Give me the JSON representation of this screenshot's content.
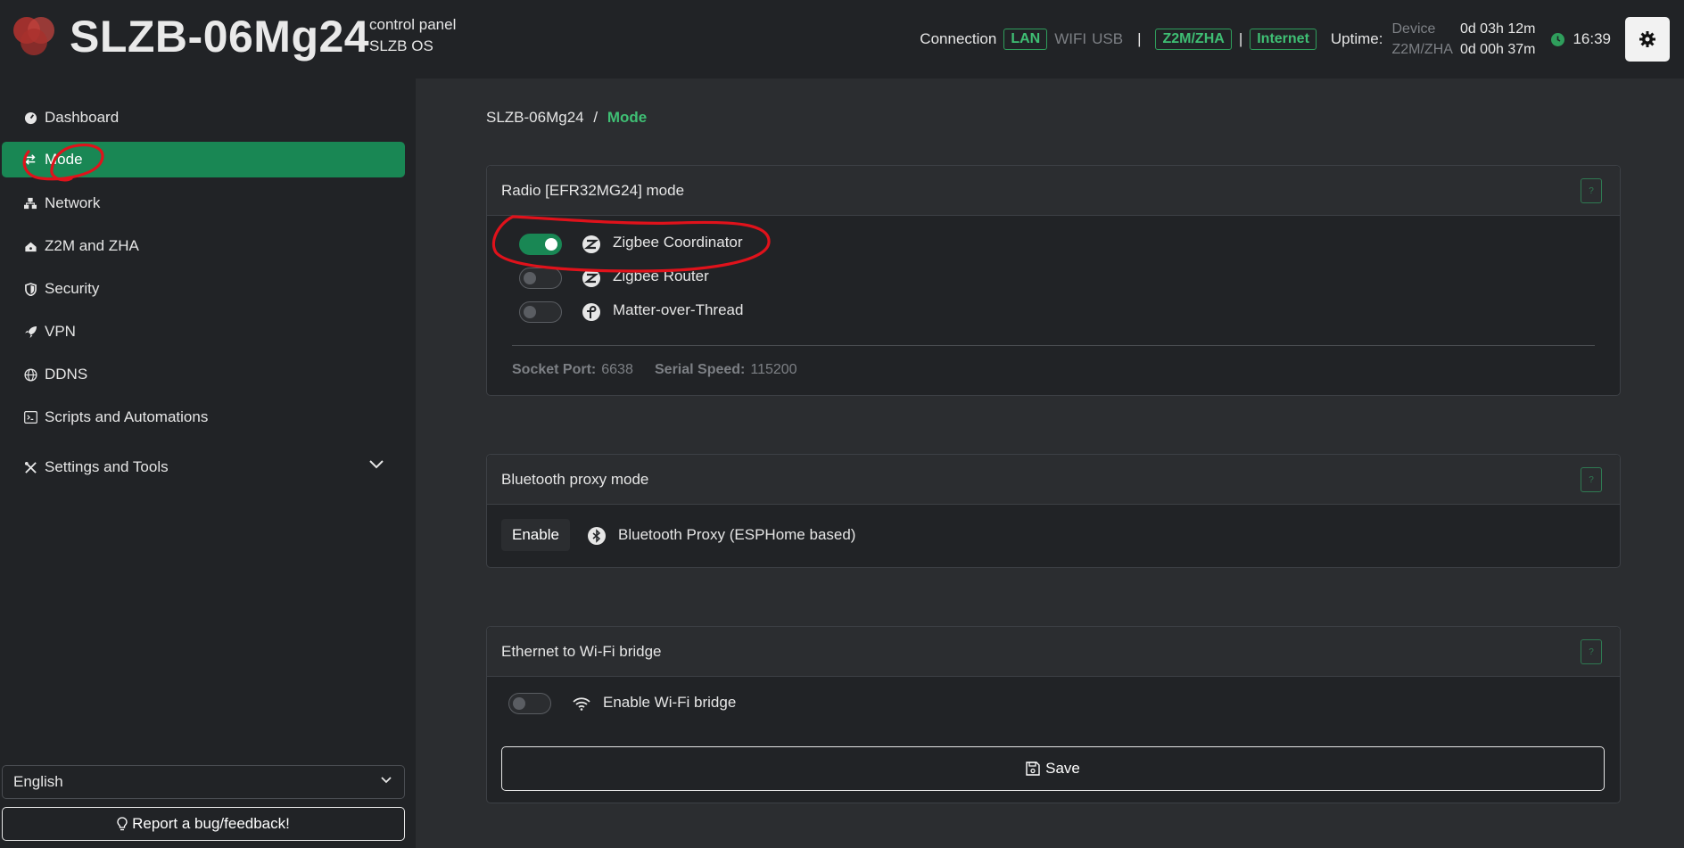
{
  "header": {
    "brand": "SLZB-06Mg24",
    "sub_line1": "control panel",
    "sub_line2": "SLZB OS",
    "connection_label": "Connection",
    "conn_lan": "LAN",
    "conn_wifi": "WIFI",
    "conn_usb": "USB",
    "z2m_badge": "Z2M/ZHA",
    "internet_badge": "Internet",
    "uptime_label": "Uptime:",
    "uptime_device_label": "Device",
    "uptime_device_value": "0d 03h 12m",
    "uptime_z2m_label": "Z2M/ZHA",
    "uptime_z2m_value": "0d 00h 37m",
    "clock": "16:39",
    "sep": "|"
  },
  "sidebar": {
    "items": [
      {
        "label": "Dashboard",
        "icon": "dashboard-icon"
      },
      {
        "label": "Mode",
        "icon": "swap-arrows-icon",
        "active": true
      },
      {
        "label": "Network",
        "icon": "network-icon"
      },
      {
        "label": "Z2M and ZHA",
        "icon": "house-signal-icon"
      },
      {
        "label": "Security",
        "icon": "shield-icon"
      },
      {
        "label": "VPN",
        "icon": "rocket-icon"
      },
      {
        "label": "DDNS",
        "icon": "globe-icon"
      },
      {
        "label": "Scripts and Automations",
        "icon": "terminal-icon"
      },
      {
        "label": "Settings and Tools",
        "icon": "tools-icon"
      }
    ],
    "language": "English",
    "bug_button": "Report a bug/feedback!"
  },
  "breadcrumb": {
    "root": "SLZB-06Mg24",
    "sep": "/",
    "current": "Mode"
  },
  "radio_card": {
    "title": "Radio [EFR32MG24] mode",
    "help": "?",
    "options": [
      {
        "label": "Zigbee Coordinator",
        "enabled": true
      },
      {
        "label": "Zigbee Router",
        "enabled": false
      },
      {
        "label": "Matter-over-Thread",
        "enabled": false
      }
    ],
    "socket_port_label": "Socket Port:",
    "socket_port_value": "6638",
    "serial_speed_label": "Serial Speed:",
    "serial_speed_value": "115200"
  },
  "bt_card": {
    "title": "Bluetooth proxy mode",
    "help": "?",
    "enable_button": "Enable",
    "label": "Bluetooth Proxy (ESPHome based)"
  },
  "bridge_card": {
    "title": "Ethernet to Wi-Fi bridge",
    "help": "?",
    "toggle_label": "Enable Wi-Fi bridge",
    "enabled": false,
    "save_button": "Save"
  },
  "colors": {
    "accent": "#198754",
    "bg": "#2b2d30",
    "panel": "#212326",
    "annotation": "#e0121b"
  }
}
